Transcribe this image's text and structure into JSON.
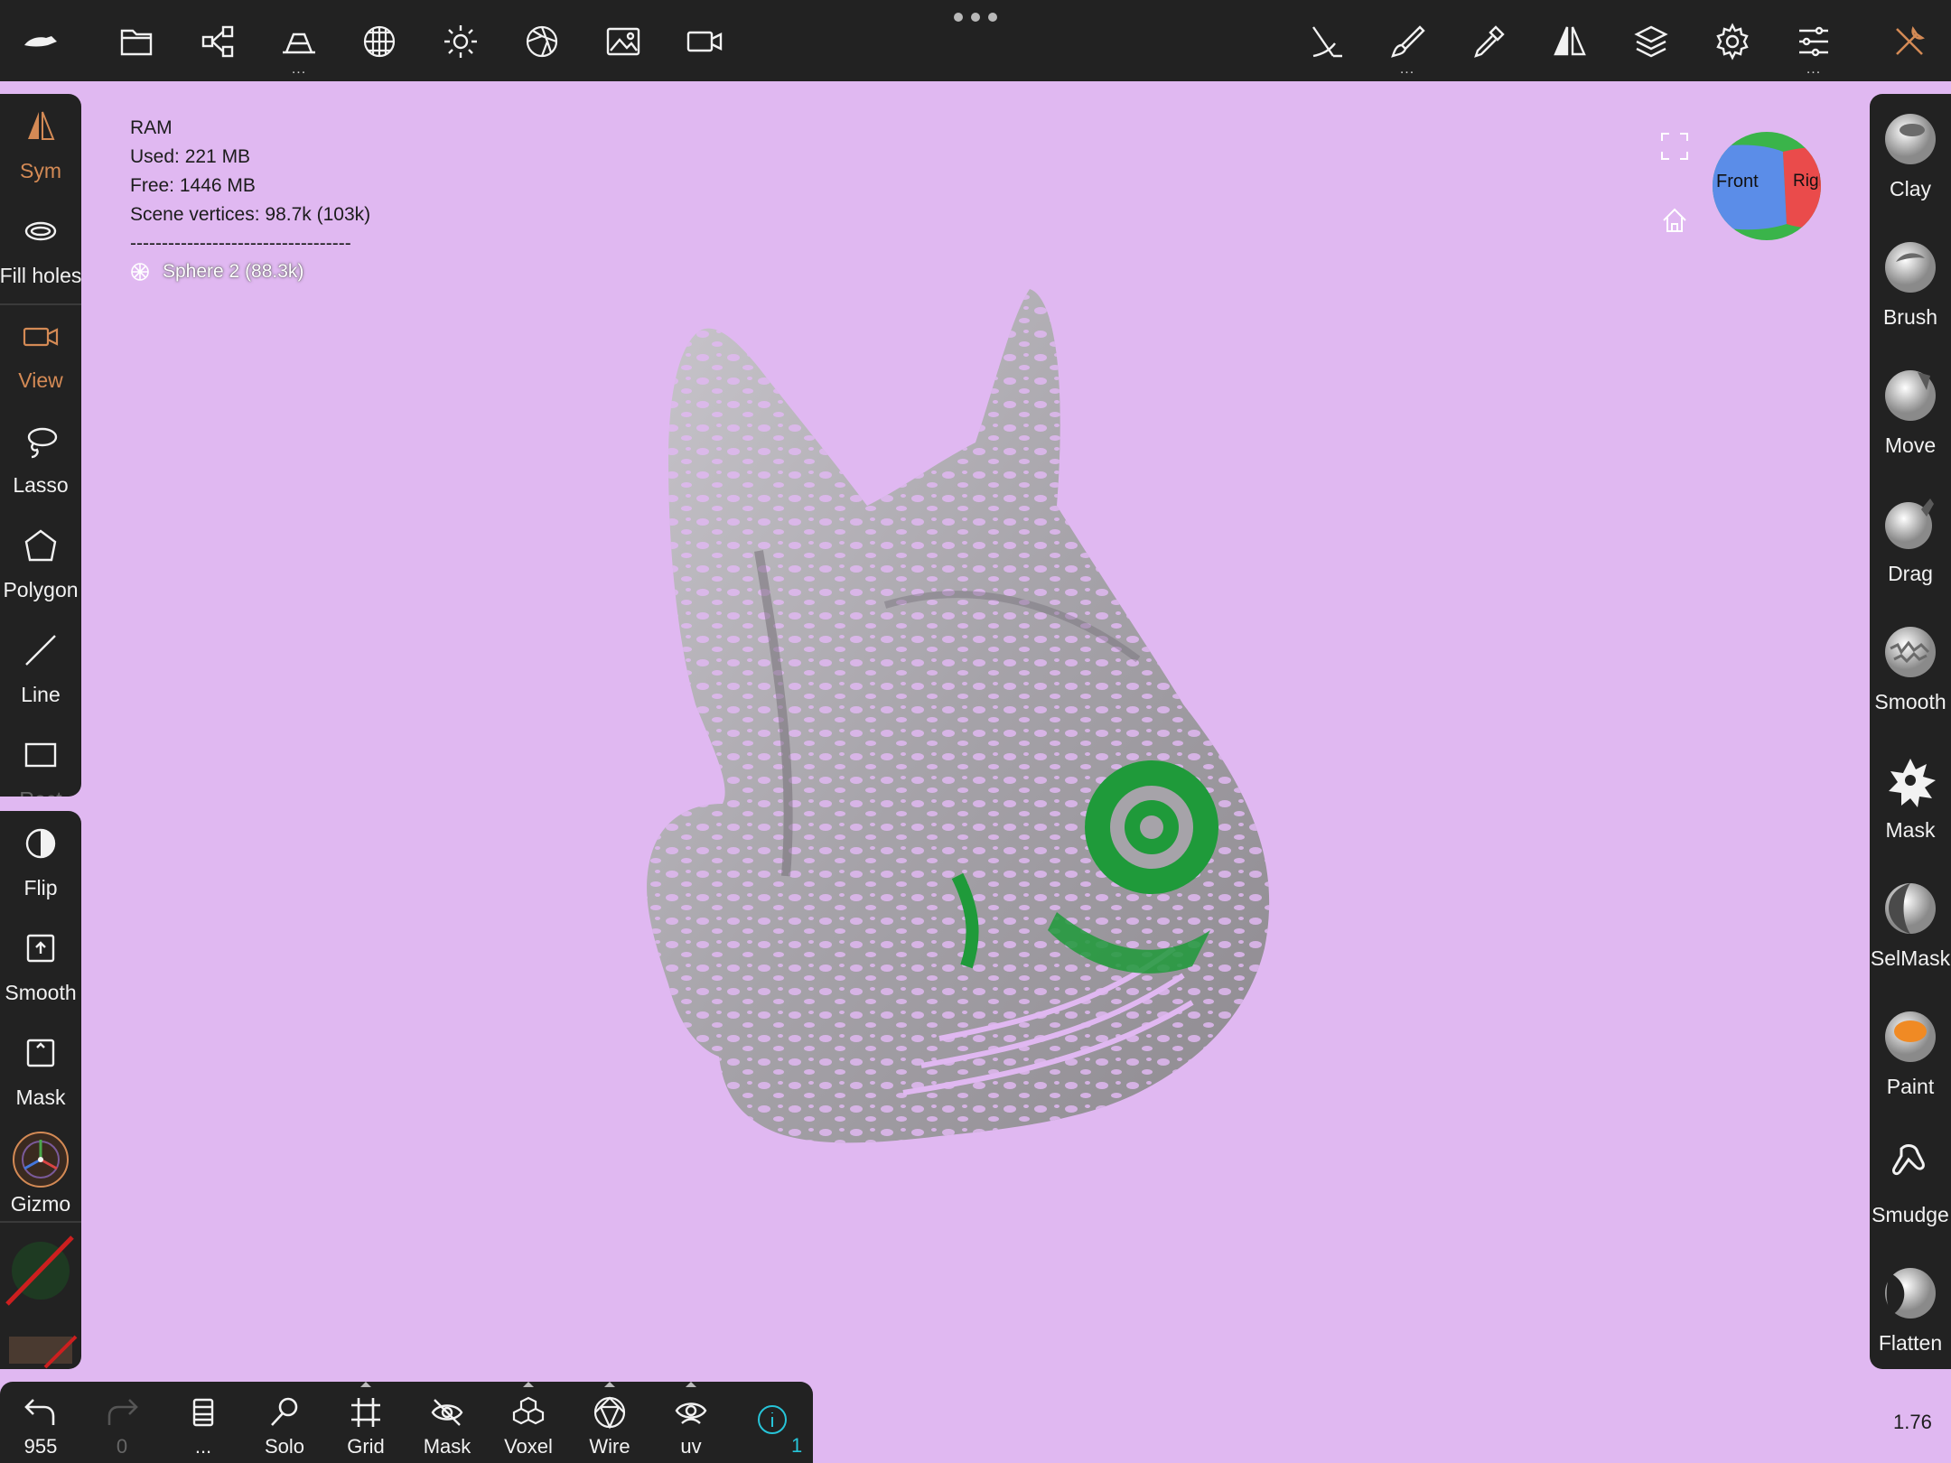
{
  "colors": {
    "viewport_background": "#e0b8f1",
    "panel_background": "#222222",
    "active_tool_accent": "#d48a55",
    "info_accent": "#27c4d8",
    "mask_color": "#1f9a3a",
    "mesh_color": "#a9a6ad"
  },
  "topbar": {
    "icons": [
      "app-logo-icon",
      "folder-icon",
      "scene-graph-icon",
      "shelf-icon",
      "material-icon",
      "light-icon",
      "shading-icon",
      "image-icon",
      "camera-icon",
      "stroke-icon",
      "brush-icon",
      "picker-icon",
      "symmetry-icon",
      "layers-icon",
      "settings-icon",
      "sliders-icon",
      "tools-icon"
    ]
  },
  "left_tools": [
    {
      "label": "Sym",
      "icon": "symmetry-icon",
      "active": true
    },
    {
      "label": "Fill holes",
      "icon": "fill-holes-icon",
      "active": false
    },
    {
      "label": "View",
      "icon": "camera-icon",
      "active": true
    },
    {
      "label": "Lasso",
      "icon": "lasso-icon",
      "active": false
    },
    {
      "label": "Polygon",
      "icon": "polygon-icon",
      "active": false
    },
    {
      "label": "Line",
      "icon": "line-icon",
      "active": false
    },
    {
      "label": "Rect",
      "icon": "rectangle-icon",
      "active": false
    }
  ],
  "left_actions": [
    {
      "label": "Flip",
      "icon": "flip-icon"
    },
    {
      "label": "Smooth",
      "icon": "smooth-icon"
    },
    {
      "label": "Mask",
      "icon": "mask-icon"
    },
    {
      "label": "Gizmo",
      "icon": "gizmo-icon"
    }
  ],
  "right_tools": [
    {
      "label": "Clay",
      "icon": "clay-brush-icon"
    },
    {
      "label": "Brush",
      "icon": "standard-brush-icon"
    },
    {
      "label": "Move",
      "icon": "move-brush-icon"
    },
    {
      "label": "Drag",
      "icon": "drag-brush-icon"
    },
    {
      "label": "Smooth",
      "icon": "smooth-brush-icon"
    },
    {
      "label": "Mask",
      "icon": "mask-brush-icon"
    },
    {
      "label": "SelMask",
      "icon": "selmask-brush-icon"
    },
    {
      "label": "Paint",
      "icon": "paint-brush-icon"
    },
    {
      "label": "Smudge",
      "icon": "smudge-brush-icon"
    },
    {
      "label": "Flatten",
      "icon": "flatten-brush-icon"
    }
  ],
  "bottombar": {
    "undo_count": "955",
    "redo_count": "0",
    "history_label": "...",
    "solo_label": "Solo",
    "grid_label": "Grid",
    "mask_label": "Mask",
    "voxel_label": "Voxel",
    "wire_label": "Wire",
    "uv_label": "uv",
    "info_count": "1"
  },
  "stats": {
    "title": "RAM",
    "used": "Used: 221 MB",
    "free": "Free: 1446 MB",
    "vertices": "Scene vertices: 98.7k (103k)",
    "separator": "-----------------------------------",
    "scene_item": "Sphere 2 (88.3k)"
  },
  "nav_cube": {
    "front_label": "Front",
    "right_label": "Right"
  },
  "zoom_value": "1.76"
}
